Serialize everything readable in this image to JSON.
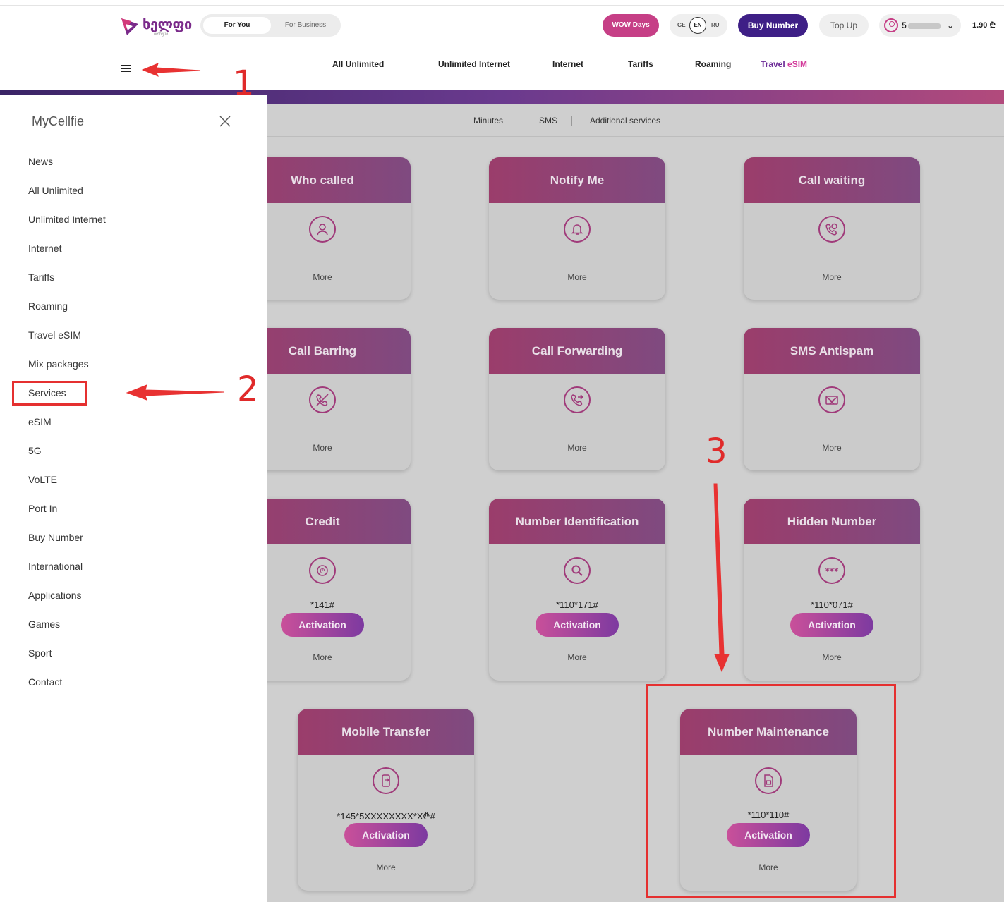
{
  "header": {
    "logo_text": "ხელფი",
    "logo_sub": "ბონუსი",
    "segment": {
      "active": "For You",
      "inactive": "For Business"
    },
    "wow_label": "WOW Days",
    "languages": [
      "GE",
      "EN",
      "RU"
    ],
    "buy_number_label": "Buy Number",
    "top_up_label": "Top Up",
    "account_number": "5",
    "balance": "1.90 ₾"
  },
  "nav": {
    "items": [
      "All Unlimited",
      "Unlimited Internet",
      "Internet",
      "Tariffs",
      "Roaming"
    ],
    "travel_prefix": "Travel",
    "travel_suffix": "eSIM"
  },
  "subnav": {
    "items": [
      "Minutes",
      "SMS",
      "Additional services"
    ]
  },
  "sidebar": {
    "title": "MyCellfie",
    "items": [
      "News",
      "All Unlimited",
      "Unlimited Internet",
      "Internet",
      "Tariffs",
      "Roaming",
      "Travel eSIM",
      "Mix packages",
      "Services",
      "eSIM",
      "5G",
      "VoLTE",
      "Port In",
      "Buy Number",
      "International",
      "Applications",
      "Games",
      "Sport",
      "Contact"
    ]
  },
  "cards": [
    {
      "title": "Who called",
      "icon": "user-icon",
      "more": "More"
    },
    {
      "title": "Notify Me",
      "icon": "bell-icon",
      "more": "More"
    },
    {
      "title": "Call waiting",
      "icon": "phone-chat-icon",
      "more": "More"
    },
    {
      "title": "Call Barring",
      "icon": "phone-blocked-icon",
      "more": "More"
    },
    {
      "title": "Call Forwarding",
      "icon": "phone-forward-icon",
      "more": "More"
    },
    {
      "title": "SMS Antispam",
      "icon": "envelope-blocked-icon",
      "more": "More"
    },
    {
      "title": "Credit",
      "icon": "coin-icon",
      "code": "*141#",
      "action": "Activation",
      "more": "More"
    },
    {
      "title": "Number Identification",
      "icon": "search-icon",
      "code": "*110*171#",
      "action": "Activation",
      "more": "More"
    },
    {
      "title": "Hidden Number",
      "icon": "asterisks-icon",
      "code": "*110*071#",
      "action": "Activation",
      "more": "More"
    },
    {
      "title": "Mobile Transfer",
      "icon": "mobile-transfer-icon",
      "code": "*145*5XXXXXXXX*X₾#",
      "action": "Activation",
      "more": "More"
    },
    {
      "title": "Number Maintenance",
      "icon": "sim-card-icon",
      "code": "*110*110#",
      "action": "Activation",
      "more": "More"
    }
  ],
  "annotations": [
    "1",
    "2",
    "3"
  ],
  "colors": {
    "brand_purple": "#3e1f86",
    "brand_pink": "#c63f86",
    "annotation_red": "#e53030"
  }
}
